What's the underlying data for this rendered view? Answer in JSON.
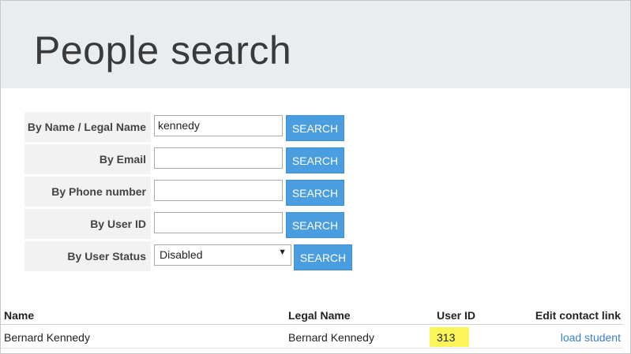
{
  "page": {
    "title": "People search"
  },
  "search_form": {
    "rows": [
      {
        "label": "By Name / Legal Name",
        "value": "kennedy",
        "button": "SEARCH"
      },
      {
        "label": "By Email",
        "value": "",
        "button": "SEARCH"
      },
      {
        "label": "By Phone number",
        "value": "",
        "button": "SEARCH"
      },
      {
        "label": "By User ID",
        "value": "",
        "button": "SEARCH"
      }
    ],
    "status": {
      "label": "By User Status",
      "selected": "Disabled",
      "button": "SEARCH"
    }
  },
  "results": {
    "headers": {
      "name": "Name",
      "legal_name": "Legal Name",
      "user_id": "User ID",
      "edit_link": "Edit contact link"
    },
    "rows": [
      {
        "name": "Bernard Kennedy",
        "legal_name": "Bernard Kennedy",
        "user_id": "313",
        "edit_link": "load student"
      }
    ]
  },
  "colors": {
    "header_bg": "#e9edf0",
    "button_bg": "#4a9ee0",
    "highlight": "#fbf55a",
    "link": "#3a7fc4"
  }
}
